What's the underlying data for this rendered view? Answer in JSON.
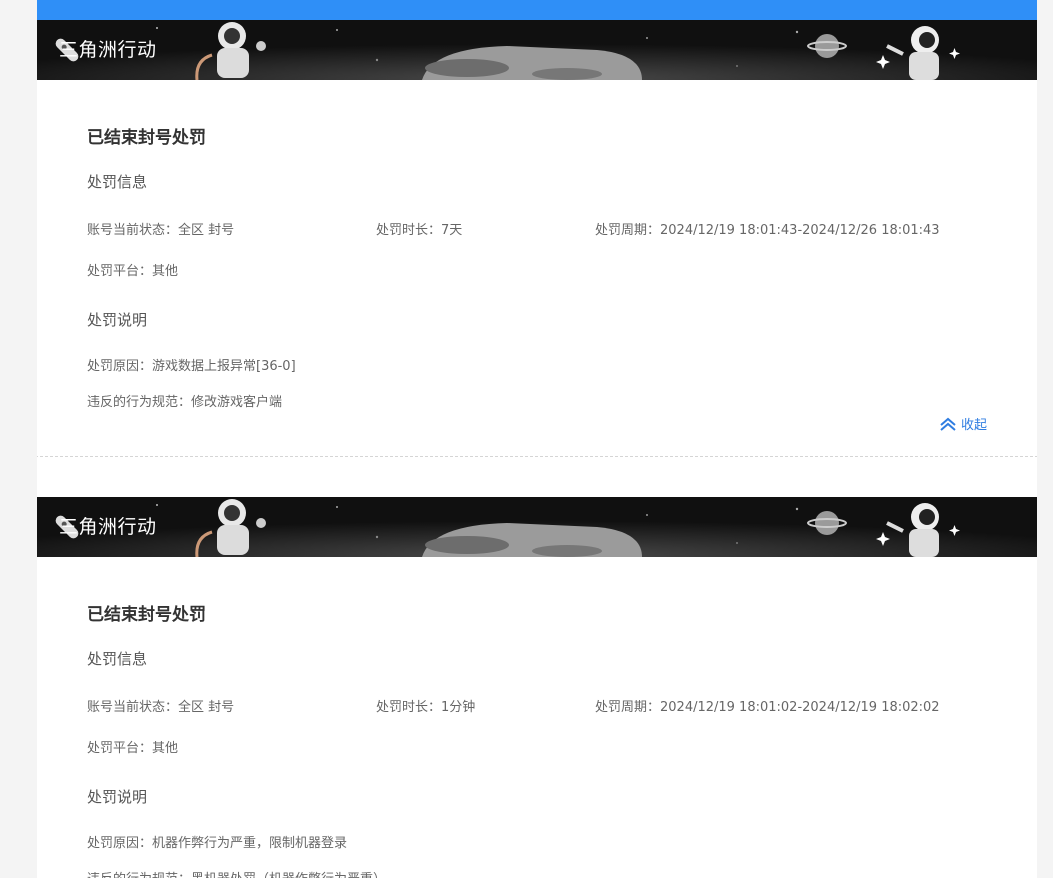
{
  "game_name": "三角洲行动",
  "records": [
    {
      "status_title": "已结束封号处罚",
      "info_section": "处罚信息",
      "account_status": "账号当前状态：全区 封号",
      "duration": "处罚时长：7天",
      "period": "处罚周期：2024/12/19 18:01:43-2024/12/26 18:01:43",
      "platform": "处罚平台：其他",
      "desc_section": "处罚说明",
      "reason": "处罚原因：游戏数据上报异常[36-0]",
      "violation": "违反的行为规范：修改游戏客户端",
      "collapse_label": "收起"
    },
    {
      "status_title": "已结束封号处罚",
      "info_section": "处罚信息",
      "account_status": "账号当前状态：全区 封号",
      "duration": "处罚时长：1分钟",
      "period": "处罚周期：2024/12/19 18:01:02-2024/12/19 18:02:02",
      "platform": "处罚平台：其他",
      "desc_section": "处罚说明",
      "reason": "处罚原因：机器作弊行为严重，限制机器登录",
      "violation": "违反的行为规范：黑机器处罚（机器作弊行为严重）"
    }
  ],
  "colors": {
    "accent": "#2f8ff7",
    "link": "#2f7de1",
    "banner_bg": "#101010"
  }
}
